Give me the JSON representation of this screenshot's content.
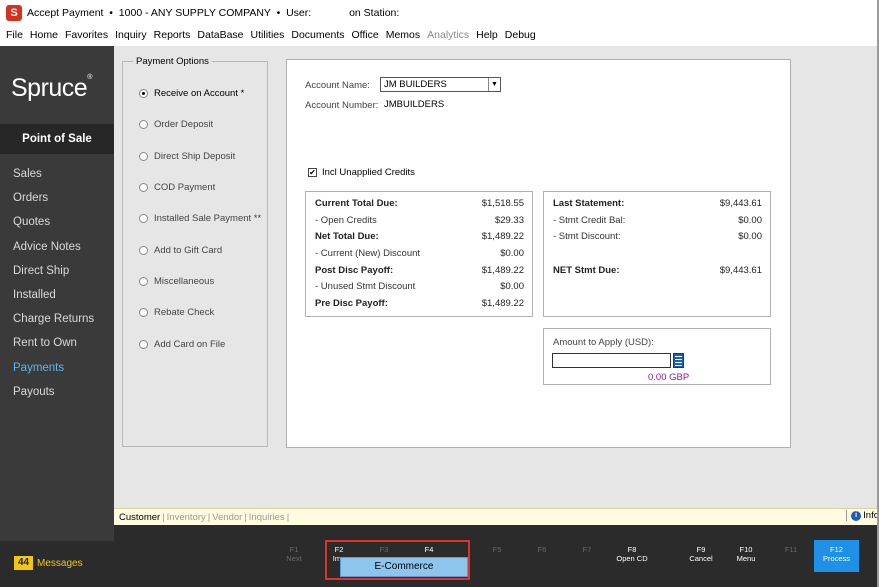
{
  "titlebar": {
    "app_icon": "S",
    "title": "Accept Payment  •  1000 - ANY SUPPLY COMPANY  •  User:             on Station:"
  },
  "menu": {
    "items": [
      {
        "label": "File",
        "enabled": true
      },
      {
        "label": "Home",
        "enabled": true
      },
      {
        "label": "Favorites",
        "enabled": true
      },
      {
        "label": "Inquiry",
        "enabled": true
      },
      {
        "label": "Reports",
        "enabled": true
      },
      {
        "label": "DataBase",
        "enabled": true
      },
      {
        "label": "Utilities",
        "enabled": true
      },
      {
        "label": "Documents",
        "enabled": true
      },
      {
        "label": "Office",
        "enabled": true
      },
      {
        "label": "Memos",
        "enabled": true
      },
      {
        "label": "Analytics",
        "enabled": false
      },
      {
        "label": "Help",
        "enabled": true
      },
      {
        "label": "Debug",
        "enabled": true
      }
    ]
  },
  "sidebar": {
    "brand": "Spruce",
    "brand_mark": "®",
    "section": "Point of Sale",
    "items": [
      {
        "label": "Sales"
      },
      {
        "label": "Orders"
      },
      {
        "label": "Quotes"
      },
      {
        "label": "Advice Notes"
      },
      {
        "label": "Direct Ship"
      },
      {
        "label": "Installed"
      },
      {
        "label": "Charge Returns"
      },
      {
        "label": "Rent to Own"
      },
      {
        "label": "Payments",
        "active": true
      },
      {
        "label": "Payouts"
      }
    ],
    "messages_count": "44",
    "messages_label": "Messages"
  },
  "payment_options": {
    "legend": "Payment Options",
    "options": [
      {
        "label": "Receive on Account *",
        "selected": true
      },
      {
        "label": "Order Deposit"
      },
      {
        "label": "Direct Ship Deposit"
      },
      {
        "label": "COD Payment"
      },
      {
        "label": "Installed Sale Payment **"
      },
      {
        "label": "Add to Gift Card"
      },
      {
        "label": "Miscellaneous"
      },
      {
        "label": "Rebate Check"
      },
      {
        "label": "Add Card on File"
      }
    ]
  },
  "account": {
    "name_label": "Account Name:",
    "name_value": "JM BUILDERS",
    "number_label": "Account Number:",
    "number_value": "JMBUILDERS",
    "incl_unapplied_label": "Incl Unapplied Credits",
    "incl_unapplied_checked": true
  },
  "totals_left": [
    {
      "label": "Current Total Due:",
      "value": "$1,518.55",
      "bold": true
    },
    {
      "label": "- Open Credits",
      "value": "$29.33"
    },
    {
      "label": "Net Total Due:",
      "value": "$1,489.22",
      "bold": true
    },
    {
      "label": "- Current (New) Discount",
      "value": "$0.00"
    },
    {
      "label": "Post Disc Payoff:",
      "value": "$1,489.22",
      "bold": true
    },
    {
      "label": "- Unused Stmt Discount",
      "value": "$0.00"
    },
    {
      "label": "Pre Disc Payoff:",
      "value": "$1,489.22",
      "bold": true
    }
  ],
  "totals_right": [
    {
      "label": "Last Statement:",
      "value": "$9,443.61",
      "bold": true
    },
    {
      "label": "- Stmt Credit Bal:",
      "value": "$0.00"
    },
    {
      "label": "- Stmt Discount:",
      "value": "$0.00"
    },
    {
      "label": "NET Stmt Due:",
      "value": "$9,443.61",
      "bold": true
    }
  ],
  "amount": {
    "label": "Amount to Apply (USD):",
    "value": "",
    "converted": "0.00 GBP"
  },
  "bottom_tabs": {
    "items": [
      {
        "label": "Customer",
        "active": true
      },
      {
        "label": "Inventory"
      },
      {
        "label": "Vendor"
      },
      {
        "label": "Inquiries"
      }
    ],
    "info_label": "Info"
  },
  "fkeys": [
    {
      "key": "F1",
      "label": "Next",
      "enabled": false
    },
    {
      "key": "F2",
      "label": "Imp",
      "enabled": true
    },
    {
      "key": "F3",
      "label": "",
      "enabled": false
    },
    {
      "key": "F4",
      "label": "",
      "enabled": true
    },
    {
      "key": "F5",
      "label": "",
      "enabled": false
    },
    {
      "key": "F6",
      "label": "",
      "enabled": false
    },
    {
      "key": "F7",
      "label": "",
      "enabled": false
    },
    {
      "key": "F8",
      "label": "Open CD",
      "enabled": true
    },
    {
      "key": "F9",
      "label": "Cancel",
      "enabled": true
    },
    {
      "key": "F10",
      "label": "Menu",
      "enabled": true
    },
    {
      "key": "F11",
      "label": "",
      "enabled": false
    },
    {
      "key": "F12",
      "label": "Process",
      "enabled": true
    }
  ],
  "popup": {
    "label": "E-Commerce"
  },
  "colors": {
    "sidebar_bg": "#3a3a3a",
    "active_nav": "#58b7ee",
    "process_button": "#1e90e8",
    "messages_badge": "#f3c613",
    "highlight_box": "#e0312b",
    "popup_bg": "#8ec5ec"
  }
}
